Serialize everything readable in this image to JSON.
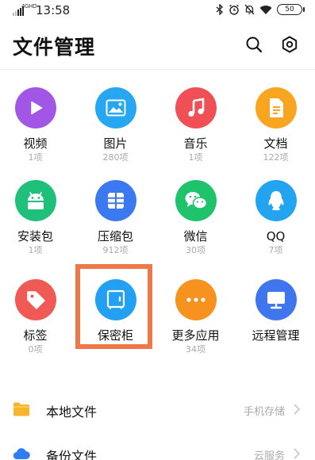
{
  "status_bar": {
    "network": "4GHD",
    "time": "13:58",
    "battery": "50"
  },
  "header": {
    "title": "文件管理",
    "search_icon": "search-icon",
    "settings_icon": "gear-icon"
  },
  "categories": [
    {
      "label": "视频",
      "count": "1项",
      "icon": "play-icon",
      "color": "#a256e6"
    },
    {
      "label": "图片",
      "count": "280项",
      "icon": "image-icon",
      "color": "#27a6f2"
    },
    {
      "label": "音乐",
      "count": "1项",
      "icon": "music-note-icon",
      "color": "#ef4f55"
    },
    {
      "label": "文档",
      "count": "122项",
      "icon": "document-icon",
      "color": "#f8a51f"
    },
    {
      "label": "安装包",
      "count": "1项",
      "icon": "android-icon",
      "color": "#1fc07a"
    },
    {
      "label": "压缩包",
      "count": "912项",
      "icon": "archive-icon",
      "color": "#3b79f0"
    },
    {
      "label": "微信",
      "count": "30项",
      "icon": "wechat-icon",
      "color": "#1fc36b"
    },
    {
      "label": "QQ",
      "count": "7项",
      "icon": "qq-icon",
      "color": "#23a4f0"
    },
    {
      "label": "标签",
      "count": "0项",
      "icon": "tag-icon",
      "color": "#f05a54"
    },
    {
      "label": "保密柜",
      "count": "",
      "icon": "safe-icon",
      "color": "#22a0f2"
    },
    {
      "label": "更多应用",
      "count": "34项",
      "icon": "more-icon",
      "color": "#f7921e"
    },
    {
      "label": "远程管理",
      "count": "",
      "icon": "monitor-icon",
      "color": "#3f76ee"
    }
  ],
  "list": [
    {
      "label": "本地文件",
      "detail": "手机存储",
      "icon": "folder-icon",
      "color": "#f7b52c"
    },
    {
      "label": "备份文件",
      "detail": "云服务",
      "icon": "cloud-icon",
      "color": "#2f7df0"
    }
  ]
}
